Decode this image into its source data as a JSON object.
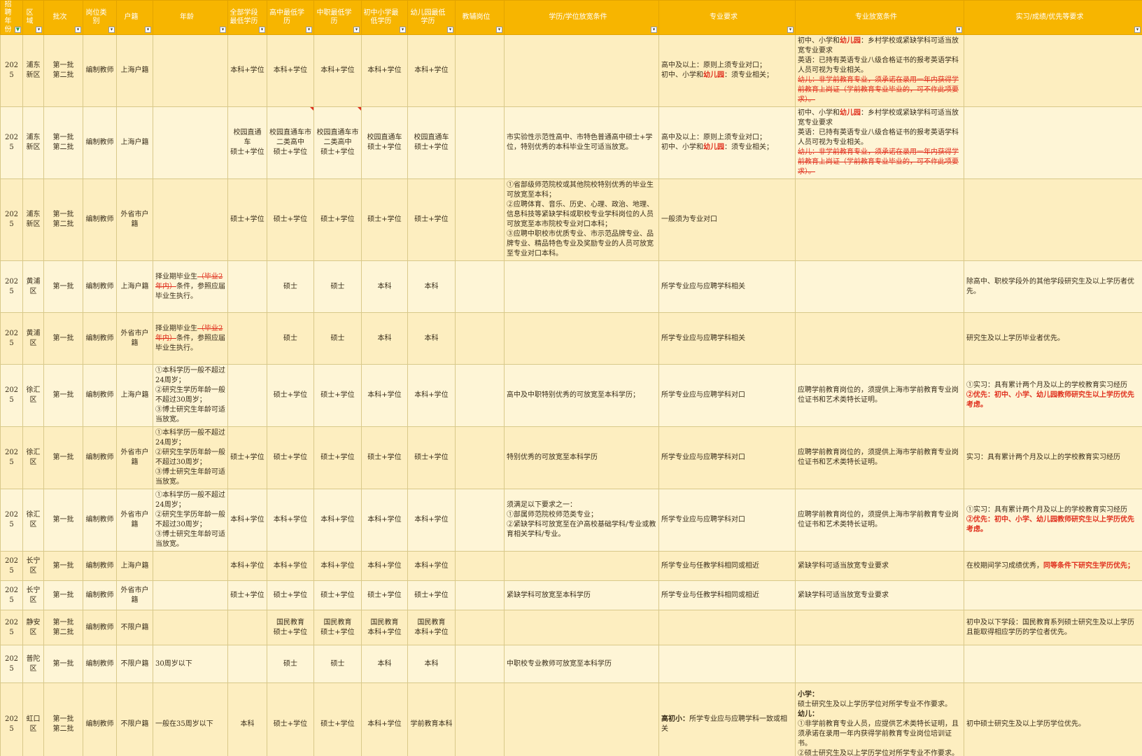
{
  "headers": [
    "招聘年份",
    "区域",
    "批次",
    "岗位类别",
    "户籍",
    "年龄",
    "全部学段最低学历",
    "高中最低学历",
    "中职最低学历",
    "初中小学最低学历",
    "幼儿园最低学历",
    "教辅岗位",
    "学历/学位放宽条件",
    "专业要求",
    "专业放宽条件",
    "实习/成绩/优先等要求"
  ],
  "rows": [
    {
      "year": "2025",
      "district": "浦东新区",
      "batch": "第一批\n第二批",
      "category": "编制教师",
      "huji": "上海户籍",
      "age": [],
      "all": "本科+学位",
      "high": "本科+学位",
      "voc": "本科+学位",
      "mid": "本科+学位",
      "kid": "本科+学位",
      "aux": "",
      "relax": [],
      "major": [
        [
          {
            "t": "高中及以上：原则上须专业对口；"
          }
        ],
        [
          {
            "t": "初中、小学和"
          },
          {
            "t": "幼儿园",
            "s": "redb"
          },
          {
            "t": "：须专业相关；"
          }
        ]
      ],
      "majorRelax": [
        [
          {
            "t": "初中、小学和"
          },
          {
            "t": "幼儿园",
            "s": "redb"
          },
          {
            "t": "：乡村学校或紧缺学科可适当放宽专业要求"
          }
        ],
        [
          {
            "t": "英语：已持有英语专业八级合格证书的报考英语学科人员可视为专业相关。"
          }
        ],
        [
          {
            "t": "幼儿：非学前教育专业，须承诺在录用一年内获得学前教育上岗证（学前教育专业毕业的，可不作此项要求）。",
            "s": "strike"
          }
        ]
      ],
      "other": []
    },
    {
      "year": "2025",
      "district": "浦东新区",
      "batch": "第一批\n第二批",
      "category": "编制教师",
      "huji": "上海户籍",
      "age": [],
      "all": "校园直通车\n硕士+学位",
      "high": "校园直通车市\n二类高中\n硕士+学位",
      "voc": "校园直通车市\n二类高中\n硕士+学位",
      "mid": "校园直通车\n硕士+学位",
      "kid": "校园直通车\n硕士+学位",
      "aux": "",
      "relax": [
        [
          {
            "t": "市实验性示范性高中、市特色普通高中硕士+学位，特别优秀的本科毕业生可适当放宽。"
          }
        ]
      ],
      "major": [
        [
          {
            "t": "高中及以上：原则上须专业对口；"
          }
        ],
        [
          {
            "t": "初中、小学和"
          },
          {
            "t": "幼儿园",
            "s": "redb"
          },
          {
            "t": "：须专业相关；"
          }
        ]
      ],
      "majorRelax": [
        [
          {
            "t": "初中、小学和"
          },
          {
            "t": "幼儿园",
            "s": "redb"
          },
          {
            "t": "：乡村学校或紧缺学科可适当放宽专业要求"
          }
        ],
        [
          {
            "t": "英语：已持有英语专业八级合格证书的报考英语学科人员可视为专业相关。"
          }
        ],
        [
          {
            "t": "幼儿：非学前教育专业，须承诺在录用一年内获得学前教育上岗证（学前教育专业毕业的，可不作此项要求）。",
            "s": "strike"
          }
        ]
      ],
      "other": []
    },
    {
      "year": "2025",
      "district": "浦东新区",
      "batch": "第一批\n第二批",
      "category": "编制教师",
      "huji": "外省市户籍",
      "age": [],
      "all": "硕士+学位",
      "high": "硕士+学位",
      "voc": "硕士+学位",
      "mid": "硕士+学位",
      "kid": "硕士+学位",
      "aux": "",
      "relax": [
        [
          {
            "t": "①省部级师范院校或其他院校特别优秀的毕业生可放宽至本科；"
          }
        ],
        [
          {
            "t": "②应聘体育、音乐、历史、心理、政治、地理、信息科技等紧缺学科或职校专业学科岗位的人员可放宽至本市院校专业对口本科；"
          }
        ],
        [
          {
            "t": "③应聘中职校市优质专业、市示范品牌专业、品牌专业、精品特色专业及奖励专业的人员可放宽至专业对口本科。"
          }
        ]
      ],
      "major": [
        [
          {
            "t": "一般须为专业对口"
          }
        ]
      ],
      "majorRelax": [],
      "other": []
    },
    {
      "year": "2025",
      "district": "黄浦区",
      "batch": "第一批",
      "category": "编制教师",
      "huji": "上海户籍",
      "age": [
        [
          {
            "t": "择业期毕业生"
          },
          {
            "t": "（毕业2年内）",
            "s": "strike"
          },
          {
            "t": "条件，参照应届毕业生执行。"
          }
        ]
      ],
      "all": "",
      "high": "硕士",
      "voc": "硕士",
      "mid": "本科",
      "kid": "本科",
      "aux": "",
      "relax": [],
      "major": [
        [
          {
            "t": "所学专业应与应聘学科相关"
          }
        ]
      ],
      "majorRelax": [],
      "other": [
        [
          {
            "t": "除高中、职校学段外的其他学段研究生及以上学历者优先。"
          }
        ]
      ]
    },
    {
      "year": "2025",
      "district": "黄浦区",
      "batch": "第一批",
      "category": "编制教师",
      "huji": "外省市户籍",
      "age": [
        [
          {
            "t": "择业期毕业生"
          },
          {
            "t": "（毕业2年内）",
            "s": "strike"
          },
          {
            "t": "条件，参照应届毕业生执行。"
          }
        ]
      ],
      "all": "",
      "high": "硕士",
      "voc": "硕士",
      "mid": "本科",
      "kid": "本科",
      "aux": "",
      "relax": [],
      "major": [
        [
          {
            "t": "所学专业应与应聘学科相关"
          }
        ]
      ],
      "majorRelax": [],
      "other": [
        [
          {
            "t": "研究生及以上学历毕业者优先。"
          }
        ]
      ]
    },
    {
      "year": "2025",
      "district": "徐汇区",
      "batch": "第一批",
      "category": "编制教师",
      "huji": "上海户籍",
      "age": [
        [
          {
            "t": "①本科学历一般不超过24周岁；"
          }
        ],
        [
          {
            "t": "②研究生学历年龄一般不超过30周岁；"
          }
        ],
        [
          {
            "t": "③博士研究生年龄可适当放宽。"
          }
        ]
      ],
      "all": "",
      "high": "硕士+学位",
      "voc": "硕士+学位",
      "mid": "本科+学位",
      "kid": "本科+学位",
      "aux": "",
      "relax": [
        [
          {
            "t": "高中及中职特别优秀的可放宽至本科学历；"
          }
        ]
      ],
      "major": [
        [
          {
            "t": "所学专业应与应聘学科对口"
          }
        ]
      ],
      "majorRelax": [
        [
          {
            "t": "应聘学前教育岗位的，须提供上海市学前教育专业岗位证书和艺术类特长证明。"
          }
        ]
      ],
      "other": [
        [
          {
            "t": "①实习：具有累计两个月及以上的学校教育实习经历"
          }
        ],
        [
          {
            "t": "②优先：初中、小学、幼儿园教师研究生以上学历优先考虑。",
            "s": "redb"
          }
        ]
      ]
    },
    {
      "year": "2025",
      "district": "徐汇区",
      "batch": "第一批",
      "category": "编制教师",
      "huji": "外省市户籍",
      "age": [
        [
          {
            "t": "①本科学历一般不超过24周岁；"
          }
        ],
        [
          {
            "t": "②研究生学历年龄一般不超过30周岁；"
          }
        ],
        [
          {
            "t": "③博士研究生年龄可适当放宽。"
          }
        ]
      ],
      "all": "硕士+学位",
      "high": "硕士+学位",
      "voc": "硕士+学位",
      "mid": "硕士+学位",
      "kid": "硕士+学位",
      "aux": "",
      "relax": [
        [
          {
            "t": "特别优秀的可放宽至本科学历"
          }
        ]
      ],
      "major": [
        [
          {
            "t": "所学专业应与应聘学科对口"
          }
        ]
      ],
      "majorRelax": [
        [
          {
            "t": "应聘学前教育岗位的，须提供上海市学前教育专业岗位证书和艺术类特长证明。"
          }
        ]
      ],
      "other": [
        [
          {
            "t": "实习：具有累计两个月及以上的学校教育实习经历"
          }
        ]
      ]
    },
    {
      "year": "2025",
      "district": "徐汇区",
      "batch": "第一批",
      "category": "编制教师",
      "huji": "外省市户籍",
      "age": [
        [
          {
            "t": "①本科学历一般不超过24周岁；"
          }
        ],
        [
          {
            "t": "②研究生学历年龄一般不超过30周岁；"
          }
        ],
        [
          {
            "t": "③博士研究生年龄可适当放宽。"
          }
        ]
      ],
      "all": "本科+学位",
      "high": "本科+学位",
      "voc": "本科+学位",
      "mid": "本科+学位",
      "kid": "本科+学位",
      "aux": "",
      "relax": [
        [
          {
            "t": "须满足以下要求之一："
          }
        ],
        [
          {
            "t": "①部属师范院校师范类专业；"
          }
        ],
        [
          {
            "t": "②紧缺学科可放宽至在沪高校基础学科/专业或教育相关学科/专业。"
          }
        ]
      ],
      "major": [
        [
          {
            "t": "所学专业应与应聘学科对口"
          }
        ]
      ],
      "majorRelax": [
        [
          {
            "t": "应聘学前教育岗位的，须提供上海市学前教育专业岗位证书和艺术类特长证明。"
          }
        ]
      ],
      "other": [
        [
          {
            "t": "①实习：具有累计两个月及以上的学校教育实习经历"
          }
        ],
        [
          {
            "t": "②优先：初中、小学、幼儿园教师研究生以上学历优先考虑。",
            "s": "redb"
          }
        ]
      ]
    },
    {
      "year": "2025",
      "district": "长宁区",
      "batch": "第一批",
      "category": "编制教师",
      "huji": "上海户籍",
      "age": [],
      "all": "本科+学位",
      "high": "本科+学位",
      "voc": "本科+学位",
      "mid": "本科+学位",
      "kid": "本科+学位",
      "aux": "",
      "relax": [],
      "major": [
        [
          {
            "t": "所学专业与任教学科相同或相近"
          }
        ]
      ],
      "majorRelax": [
        [
          {
            "t": "紧缺学科可适当放宽专业要求"
          }
        ]
      ],
      "other": [
        [
          {
            "t": "在校期间学习成绩优秀，"
          },
          {
            "t": "同等条件下研究生学历优先；",
            "s": "redb"
          }
        ]
      ]
    },
    {
      "year": "2025",
      "district": "长宁区",
      "batch": "第一批",
      "category": "编制教师",
      "huji": "外省市户籍",
      "age": [],
      "all": "硕士+学位",
      "high": "硕士+学位",
      "voc": "硕士+学位",
      "mid": "硕士+学位",
      "kid": "硕士+学位",
      "aux": "",
      "relax": [
        [
          {
            "t": "紧缺学科可放宽至本科学历"
          }
        ]
      ],
      "major": [
        [
          {
            "t": "所学专业与任教学科相同或相近"
          }
        ]
      ],
      "majorRelax": [
        [
          {
            "t": "紧缺学科可适当放宽专业要求"
          }
        ]
      ],
      "other": []
    },
    {
      "year": "2025",
      "district": "静安区",
      "batch": "第一批\n第二批",
      "category": "编制教师",
      "huji": "不限户籍",
      "age": [],
      "all": "",
      "high": "国民教育\n硕士+学位",
      "voc": "国民教育\n硕士+学位",
      "mid": "国民教育\n本科+学位",
      "kid": "国民教育\n本科+学位",
      "aux": "",
      "relax": [],
      "major": [],
      "majorRelax": [],
      "other": [
        [
          {
            "t": "初中及以下学段：国民教育系列硕士研究生及以上学历且能取得相应学历的学位者优先。"
          }
        ]
      ]
    },
    {
      "year": "2025",
      "district": "普陀区",
      "batch": "第一批",
      "category": "编制教师",
      "huji": "不限户籍",
      "age": [
        [
          {
            "t": "30周岁以下"
          }
        ]
      ],
      "all": "",
      "high": "硕士",
      "voc": "硕士",
      "mid": "本科",
      "kid": "本科",
      "aux": "",
      "relax": [
        [
          {
            "t": "中职校专业教师可放宽至本科学历"
          }
        ]
      ],
      "major": [],
      "majorRelax": [],
      "other": []
    },
    {
      "year": "2025",
      "district": "虹口区",
      "batch": "第一批\n第二批",
      "category": "编制教师",
      "huji": "不限户籍",
      "age": [
        [
          {
            "t": "一般在35周岁以下"
          }
        ]
      ],
      "all": "本科",
      "high": "硕士+学位",
      "voc": "硕士+学位",
      "mid": "本科+学位",
      "kid": "学前教育本科",
      "aux": "",
      "relax": [],
      "major": [
        [
          {
            "t": "高初小：",
            "s": "bold"
          },
          {
            "t": "所学专业应与应聘学科一致或相关"
          }
        ]
      ],
      "majorRelax": [
        [
          {
            "t": "小学：",
            "s": "bold"
          }
        ],
        [
          {
            "t": "硕士研究生及以上学历学位对所学专业不作要求。"
          }
        ],
        [
          {
            "t": "幼儿：",
            "s": "bold"
          }
        ],
        [
          {
            "t": "①非学前教育专业人员，应提供艺术类特长证明，且须承诺在录用一年内获得学前教育专业岗位培训证书。"
          }
        ],
        [
          {
            "t": "②硕士研究生及以上学历学位对所学专业不作要求。"
          }
        ]
      ],
      "other": [
        [
          {
            "t": "初中硕士研究生及以上学历学位优先。"
          }
        ]
      ]
    }
  ]
}
